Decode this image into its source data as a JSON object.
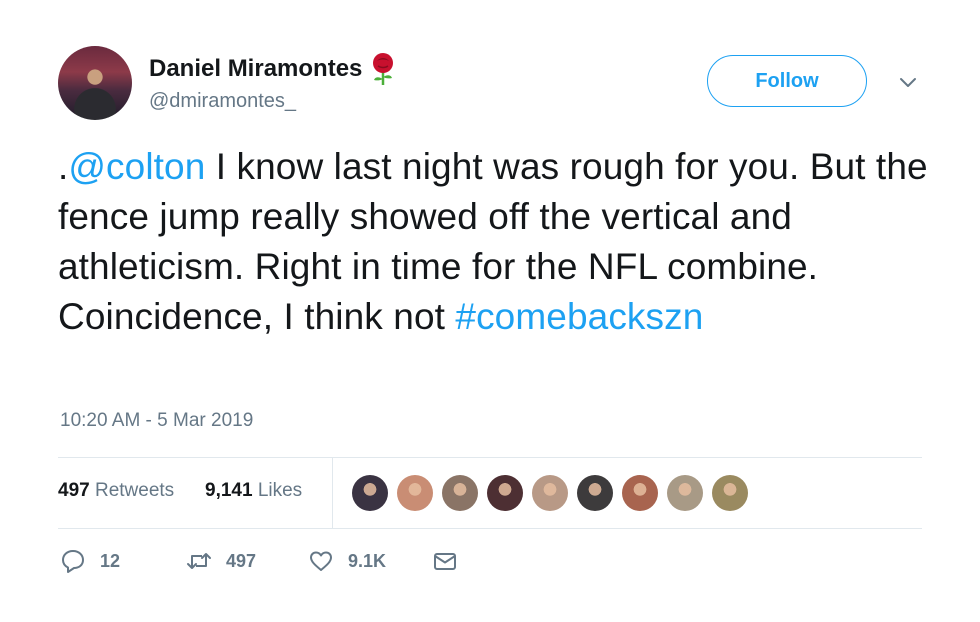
{
  "user": {
    "display_name": "Daniel Miramontes",
    "handle": "@dmiramontes_",
    "emoji_icon": "rose-emoji"
  },
  "follow_label": "Follow",
  "tweet": {
    "text_parts": [
      {
        "text": ".",
        "link": false
      },
      {
        "text": "@colton",
        "link": true
      },
      {
        "text": " I know last night was rough for you. But the fence jump really showed off the vertical and athleticism. Right in time for the NFL combine. Coincidence, I think not ",
        "link": false
      },
      {
        "text": "#comebackszn",
        "link": true
      }
    ],
    "timestamp": "10:20 AM - 5 Mar 2019"
  },
  "stats": {
    "retweets_count": "497",
    "retweets_label": "Retweets",
    "likes_count": "9,141",
    "likes_label": "Likes"
  },
  "liker_avatar_colors": [
    "#3a3342",
    "#c98d74",
    "#8a7466",
    "#4d2f33",
    "#b89986",
    "#3d3b3c",
    "#a8644f",
    "#a89a86",
    "#9a8a60"
  ],
  "actions": {
    "reply_count": "12",
    "retweet_count": "497",
    "like_count": "9.1K"
  },
  "colors": {
    "accent": "#1da1f2",
    "secondary_text": "#657786",
    "divider": "#e1e8ed"
  }
}
